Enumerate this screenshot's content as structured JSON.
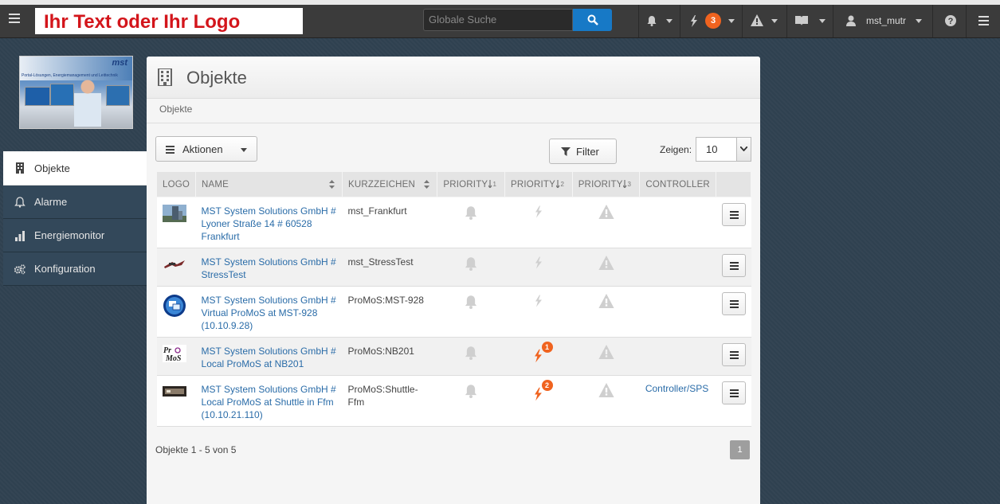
{
  "header": {
    "logo_text": "Ihr Text oder Ihr Logo",
    "search_placeholder": "Globale Suche",
    "lightning_badge": "3",
    "user_name": "mst_mutr"
  },
  "sidebar": {
    "photo_brand": "mst",
    "photo_tagline": "Portal-Lösungen, Energiemanagement und Leittechnik",
    "items": [
      {
        "label": "Objekte",
        "icon": "building-icon",
        "active": true
      },
      {
        "label": "Alarme",
        "icon": "bell-icon",
        "active": false
      },
      {
        "label": "Energiemonitor",
        "icon": "bar-chart-icon",
        "active": false
      },
      {
        "label": "Konfiguration",
        "icon": "gears-icon",
        "active": false
      }
    ]
  },
  "panel": {
    "title": "Objekte",
    "breadcrumb": "Objekte",
    "actions_label": "Aktionen",
    "filter_label": "Filter",
    "show_label": "Zeigen:",
    "page_size": "10"
  },
  "table": {
    "columns": [
      "LOGO",
      "NAME",
      "KURZZEICHEN",
      "PRIORITY",
      "PRIORITY",
      "PRIORITY",
      "CONTROLLER"
    ],
    "rows": [
      {
        "name_lines": [
          "MST System Solutions GmbH #",
          "Lyoner Straße 14 # 60528",
          "Frankfurt"
        ],
        "kurz": "mst_Frankfurt",
        "p2_count": "",
        "controller": ""
      },
      {
        "name_lines": [
          "MST System Solutions GmbH #",
          "StressTest",
          ""
        ],
        "kurz": "mst_StressTest",
        "p2_count": "",
        "controller": ""
      },
      {
        "name_lines": [
          "MST System Solutions GmbH #",
          "Virtual ProMoS at MST-928",
          "(10.10.9.28)"
        ],
        "kurz": "ProMoS:MST-928",
        "p2_count": "",
        "controller": ""
      },
      {
        "name_lines": [
          "MST System Solutions GmbH #",
          "Local ProMoS at NB201",
          ""
        ],
        "kurz": "ProMoS:NB201",
        "p2_count": "1",
        "controller": ""
      },
      {
        "name_lines": [
          "MST System Solutions GmbH #",
          "Local ProMoS at Shuttle in Ffm",
          "(10.10.21.110)"
        ],
        "kurz": "ProMoS:Shuttle-Ffm",
        "p2_count": "2",
        "controller": "Controller/SPS"
      }
    ]
  },
  "footer": {
    "info": "Objekte 1 - 5 von 5",
    "page": "1"
  },
  "colors": {
    "accent": "#1779c6",
    "alert": "#f0631f",
    "link": "#2a6ca8"
  }
}
